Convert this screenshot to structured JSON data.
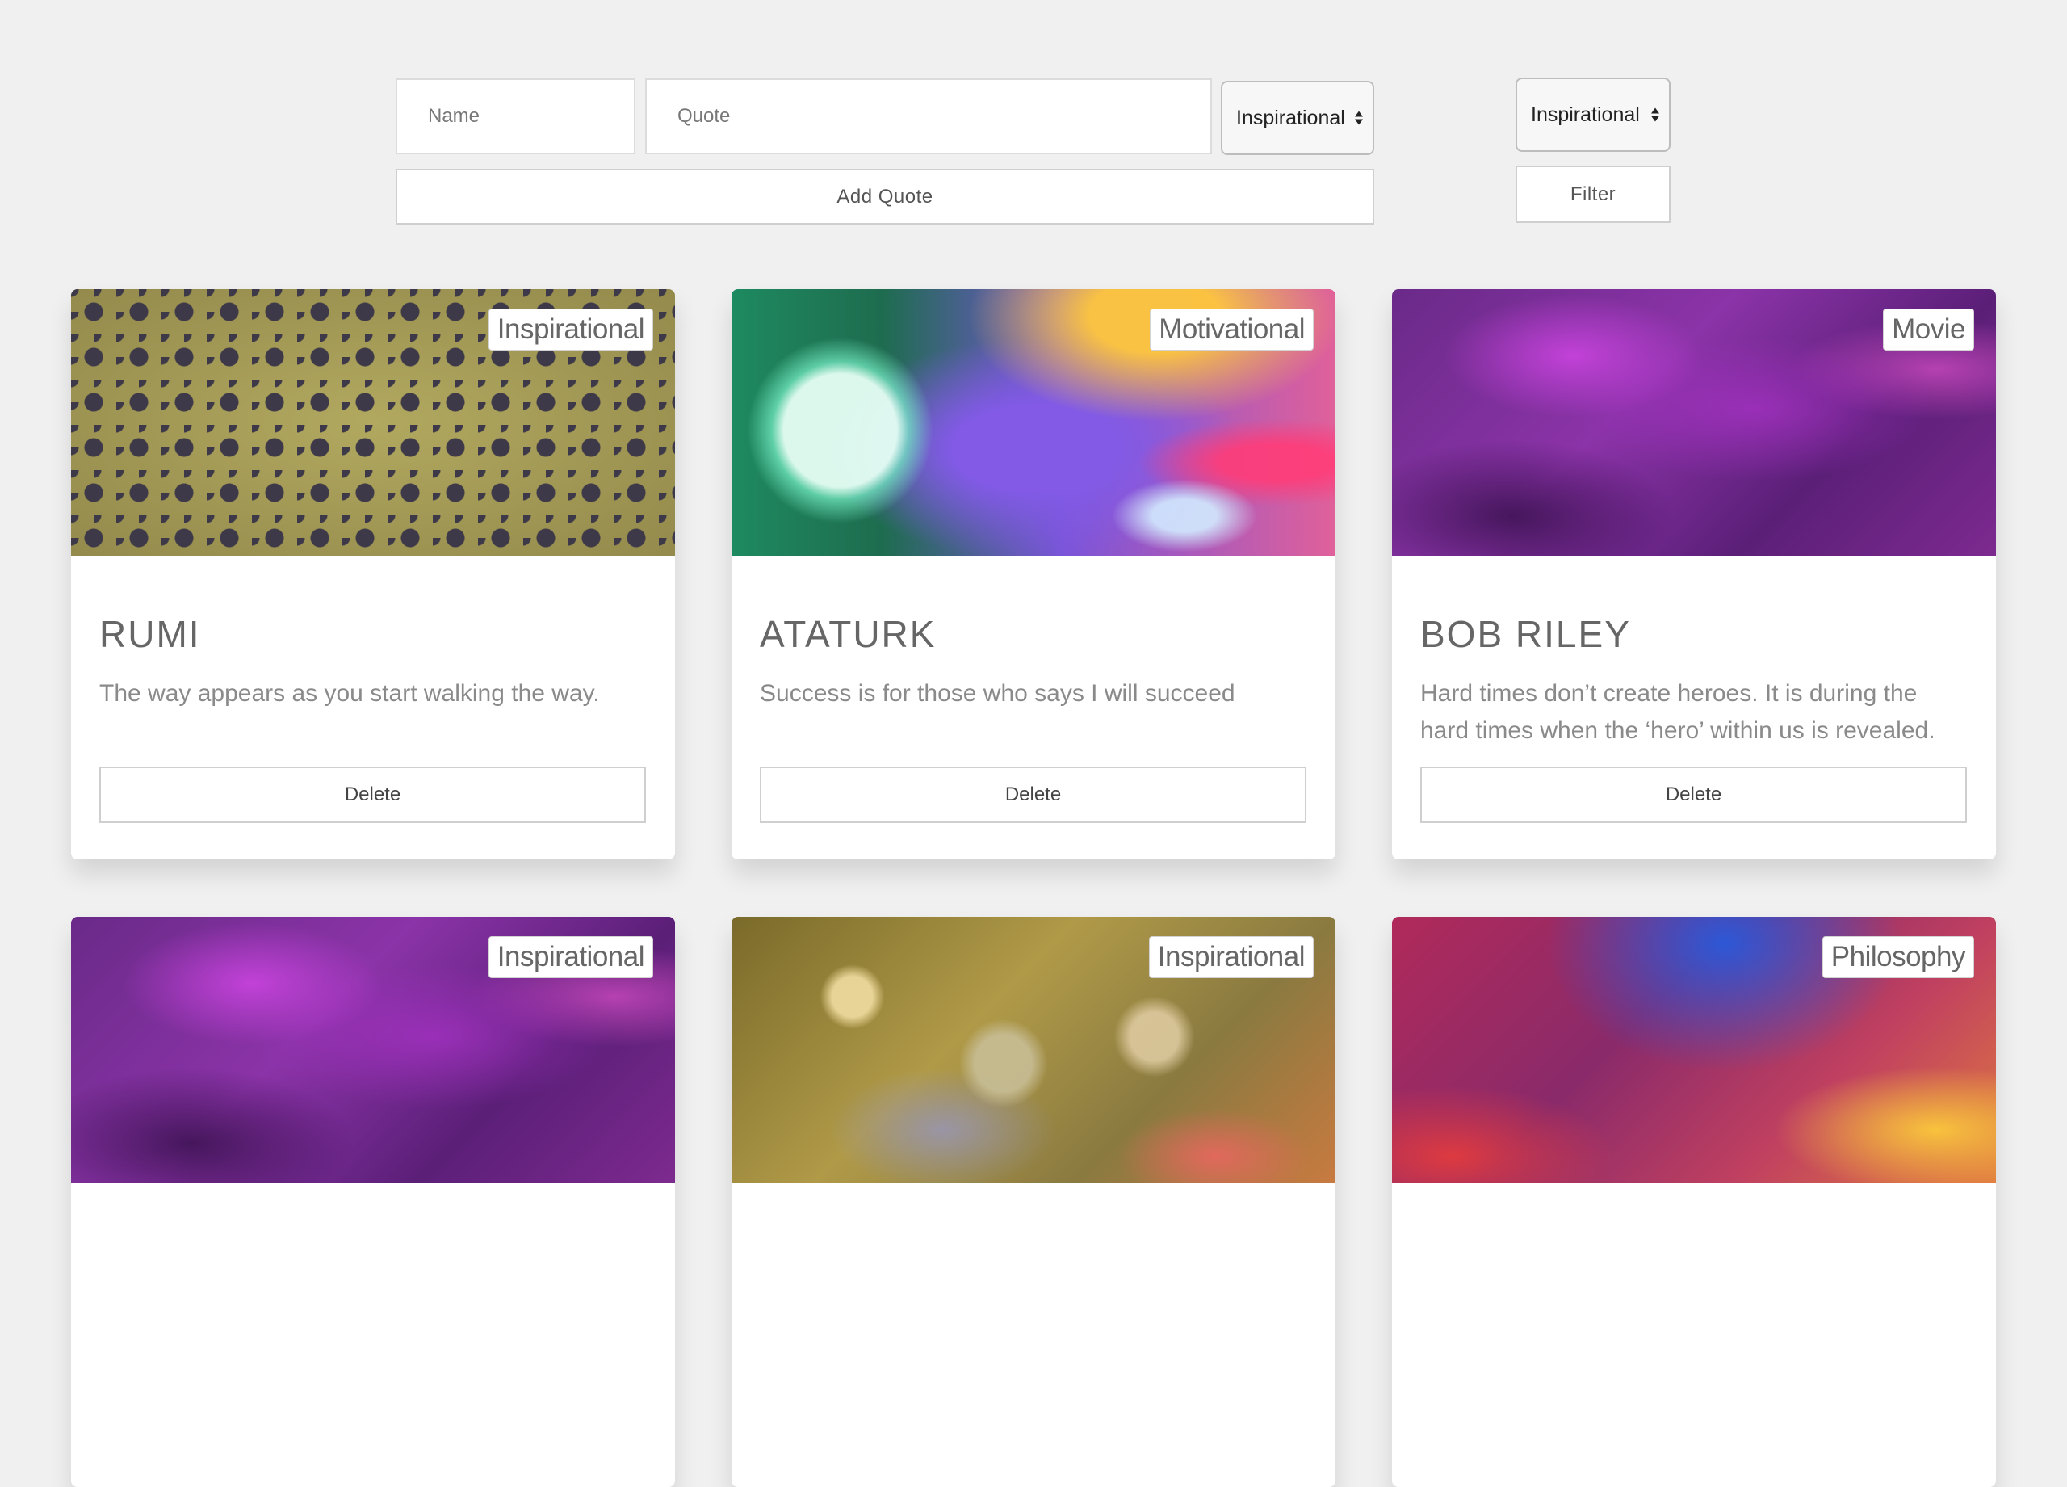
{
  "form": {
    "name_placeholder": "Name",
    "quote_placeholder": "Quote",
    "category_selected": "Inspirational",
    "add_button": "Add Quote"
  },
  "filter": {
    "category_selected": "Inspirational",
    "filter_button": "Filter"
  },
  "cards": [
    {
      "tag": "Inspirational",
      "author": "RUMI",
      "quote": "The way appears as you start walking the way.",
      "delete": "Delete"
    },
    {
      "tag": "Motivational",
      "author": "ATATURK",
      "quote": "Success is for those who says I will succeed",
      "delete": "Delete"
    },
    {
      "tag": "Movie",
      "author": "BOB RILEY",
      "quote": "Hard times don’t create heroes. It is during the hard times when the ‘hero’ within us is revealed.",
      "delete": "Delete"
    },
    {
      "tag": "Inspirational"
    },
    {
      "tag": "Inspirational"
    },
    {
      "tag": "Philosophy"
    }
  ]
}
